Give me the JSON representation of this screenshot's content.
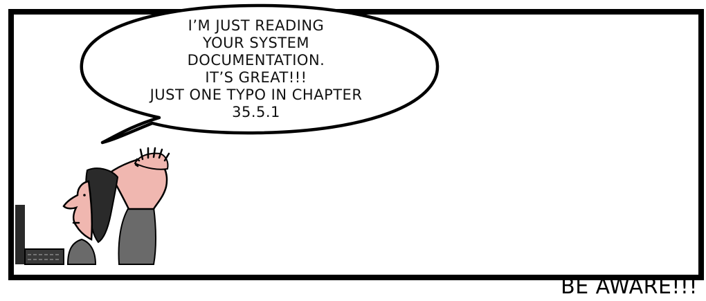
{
  "speech_bubble": {
    "lines": [
      "I’M JUST READING",
      "YOUR SYSTEM",
      "DOCUMENTATION.",
      "IT’S GREAT!!!",
      "JUST ONE TYPO IN CHAPTER",
      "35.5.1"
    ]
  },
  "caption": {
    "text": "BE AWARE!!!"
  },
  "colors": {
    "border": "#000000",
    "skin": "#f0b7b0",
    "hair": "#2a2a2a",
    "shirt": "#6a6a6a",
    "background": "#ffffff"
  }
}
